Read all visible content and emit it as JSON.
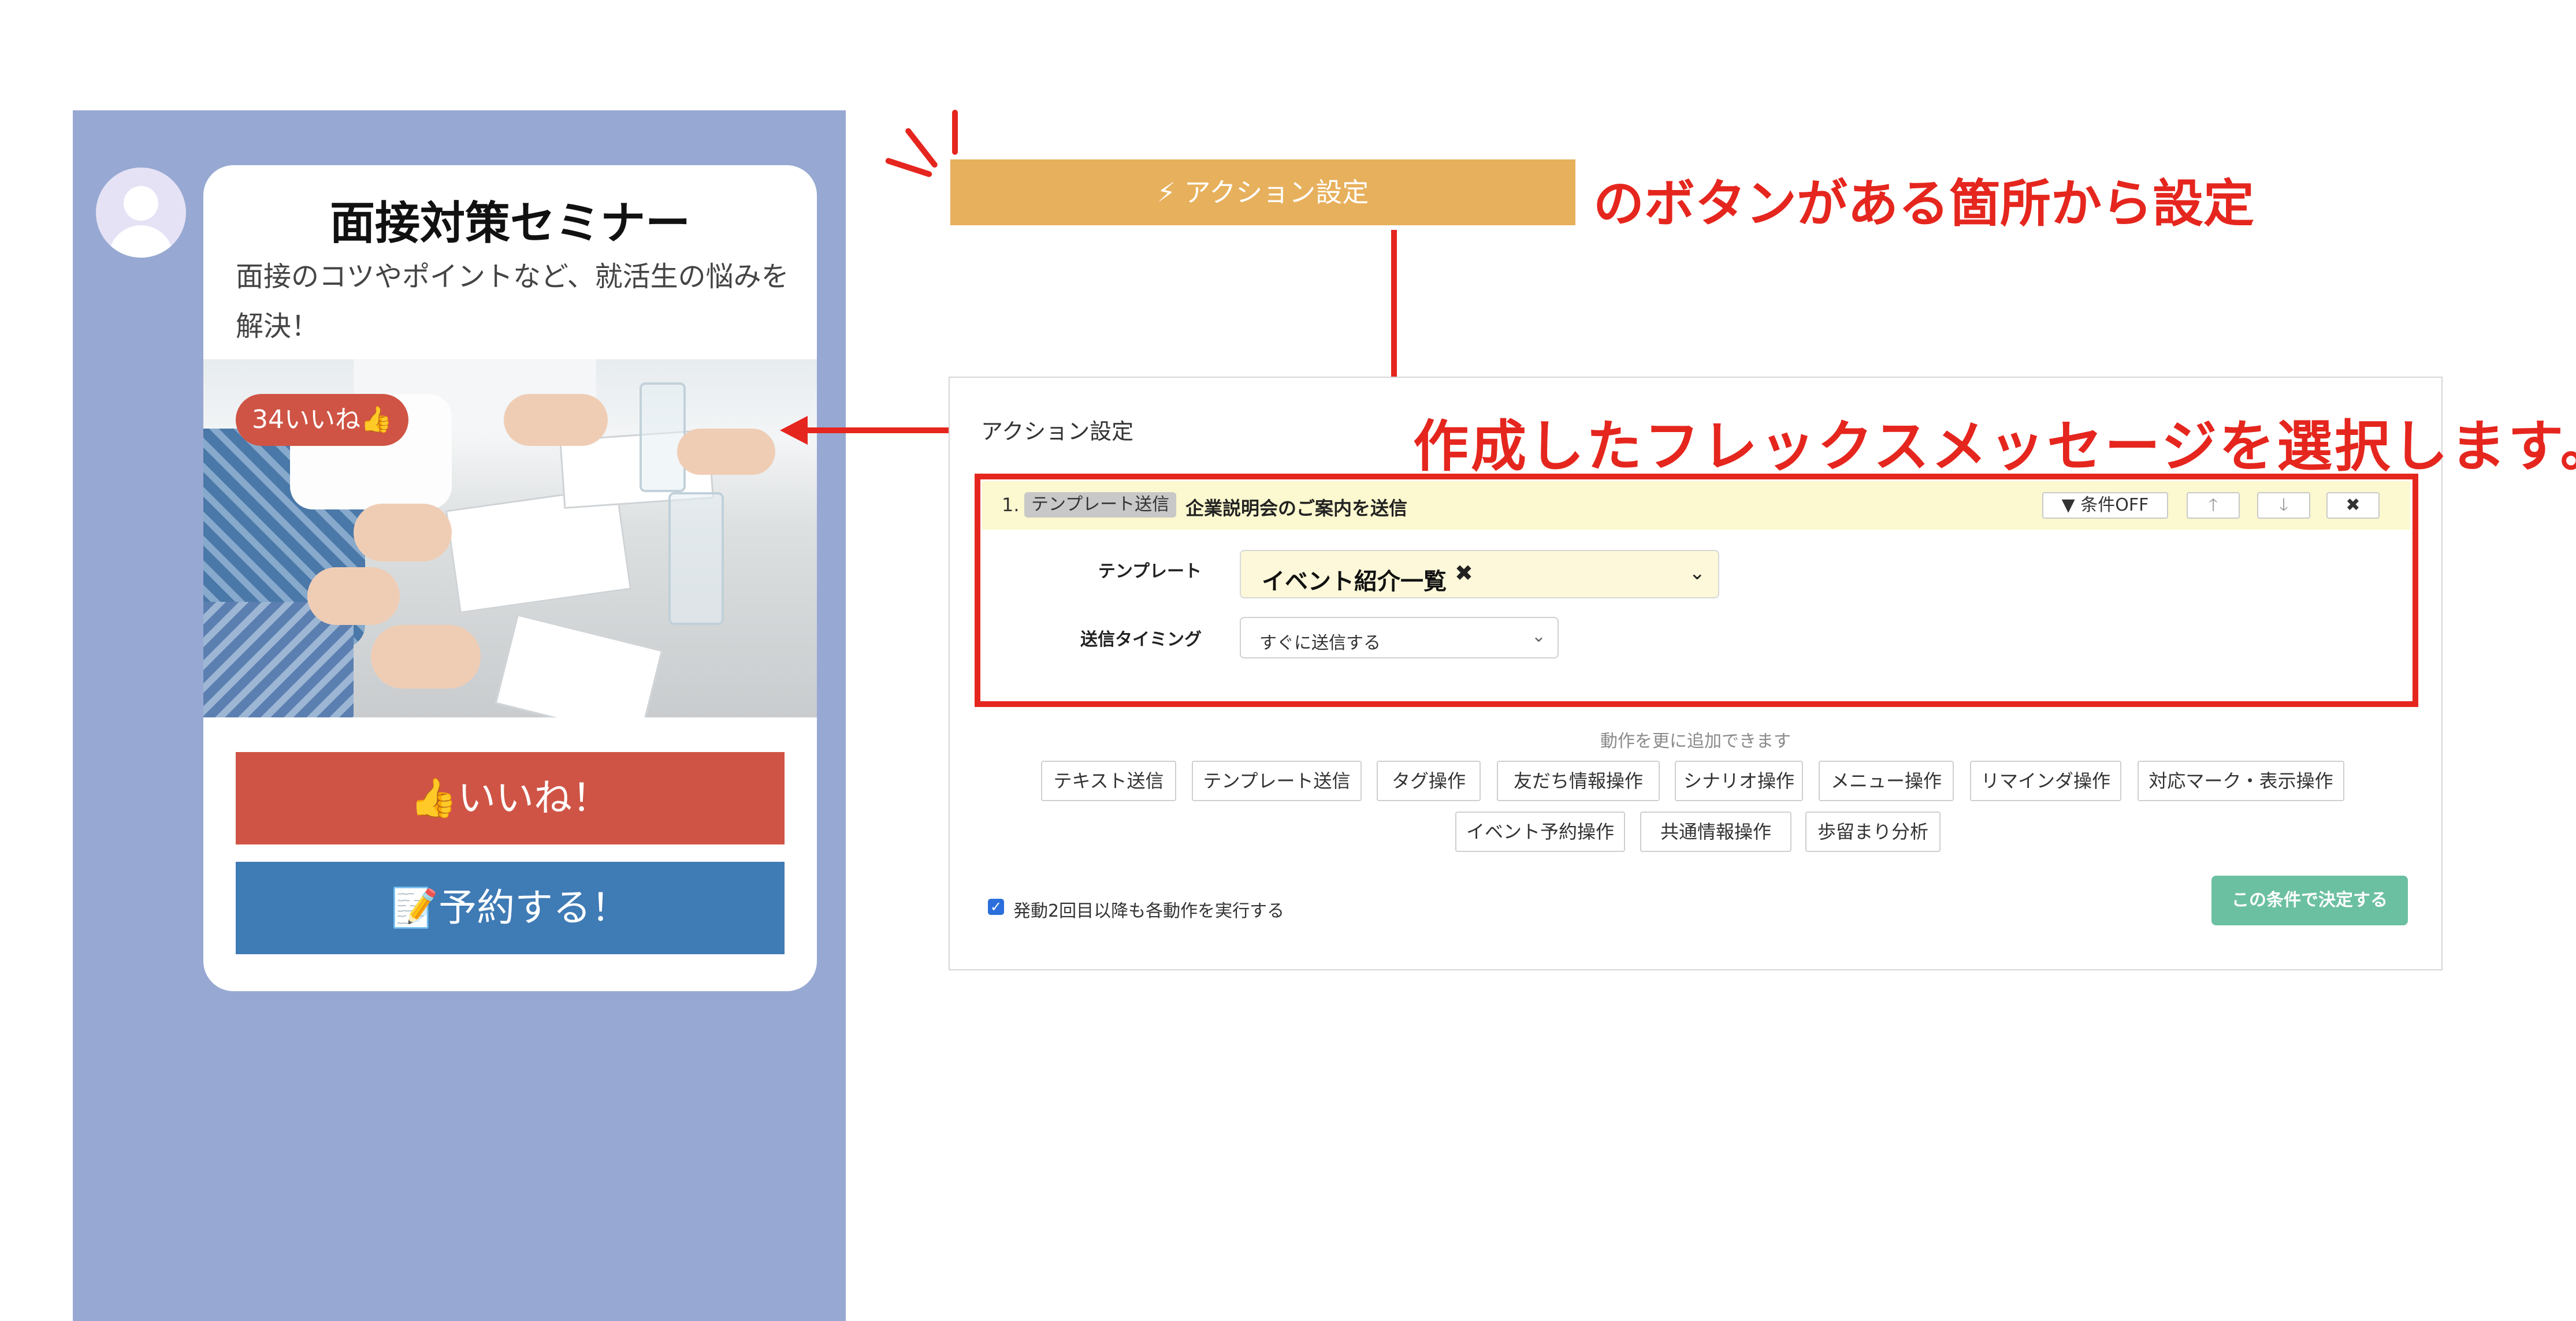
{
  "flex_message": {
    "title": "面接対策セミナー",
    "description": "面接のコツやポイントなど、就活生の悩みを解決！",
    "like_badge": "34いいね👍",
    "like_button": "👍いいね！",
    "reserve_button": "📝予約する！"
  },
  "action_button": {
    "label": "アクション設定",
    "icon": "bolt-icon"
  },
  "annotations": {
    "note_1": "のボタンがある箇所から設定",
    "note_2": "作成したフレックスメッセージを選択します。"
  },
  "settings_panel": {
    "title": "アクション設定",
    "action_row": {
      "number": "1.",
      "tag": "テンプレート送信",
      "title": "企業説明会のご案内を送信",
      "condition_button": "条件OFF",
      "condition_icon": "filter-icon",
      "move_up_icon": "arrow-up-icon",
      "move_down_icon": "arrow-down-icon",
      "delete_icon": "close-icon"
    },
    "template_field": {
      "label": "テンプレート",
      "value": "イベント紹介一覧"
    },
    "timing_field": {
      "label": "送信タイミング",
      "value": "すぐに送信する"
    },
    "add_hint": "動作を更に追加できます",
    "operations": [
      "テキスト送信",
      "テンプレート送信",
      "タグ操作",
      "友だち情報操作",
      "シナリオ操作",
      "メニュー操作",
      "リマインダ操作",
      "対応マーク・表示操作",
      "イベント予約操作",
      "共通情報操作",
      "歩留まり分析"
    ],
    "repeat_checkbox": {
      "label": "発動2回目以降も各動作を実行する",
      "checked": true
    },
    "decide_button": "この条件で決定する"
  },
  "colors": {
    "chat_background": "#97a9d2",
    "action_button": "#e7b05c",
    "annotation_red": "#e5261e",
    "like_button": "#cf5445",
    "reserve_button": "#3f7bb5",
    "decide_button": "#6cc0a2",
    "row_highlight": "#fcf8cf"
  }
}
